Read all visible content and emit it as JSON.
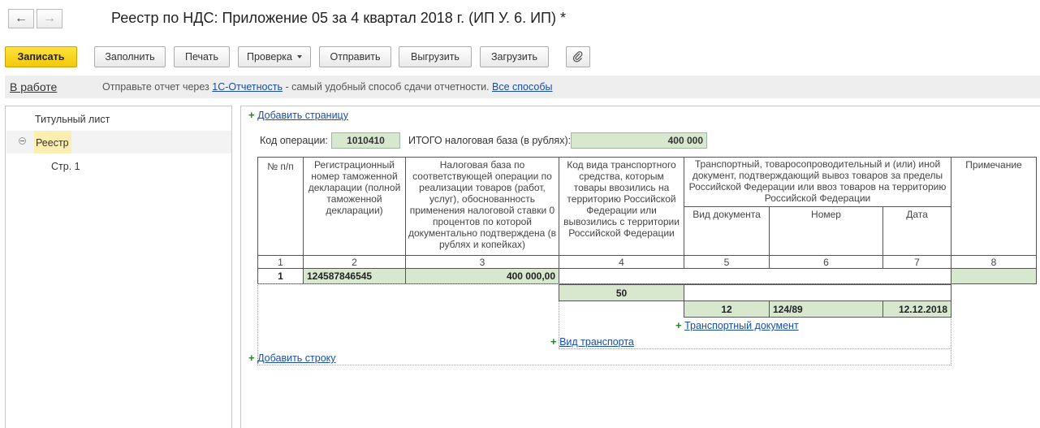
{
  "window": {
    "title": "Реестр по НДС: Приложение 05 за 4 квартал 2018 г. (ИП У. 6. ИП) *",
    "back_icon": "←",
    "forward_icon": "→"
  },
  "toolbar": {
    "save_label": "Записать",
    "fill_label": "Заполнить",
    "print_label": "Печать",
    "check_label": "Проверка",
    "send_label": "Отправить",
    "export_label": "Выгрузить",
    "import_label": "Загрузить"
  },
  "infobar": {
    "status": "В работе",
    "message_prefix": "Отправьте отчет через",
    "link_service": "1С-Отчетность",
    "message_suffix": "- самый удобный способ сдачи отчетности.",
    "link_all": "Все способы"
  },
  "tree": {
    "items": [
      "Титульный лист",
      "Реестр",
      "Стр. 1"
    ]
  },
  "form": {
    "add_page": "Добавить страницу",
    "op_code_label": "Код операции:",
    "op_code_value": "1010410",
    "total_label": "ИТОГО налоговая база (в рублях):",
    "total_value": "400 000",
    "add_row": "Добавить строку",
    "add_transport_doc": "Транспортный документ",
    "add_transport_type": "Вид транспорта"
  },
  "table": {
    "headers": {
      "c1": "№ п/п",
      "c2": "Регистрационный номер таможенной декларации (полной таможенной декларации)",
      "c3": "Налоговая база по соответствующей операции по реализации товаров (работ, услуг), обоснованность применения налоговой ставки 0 процентов по которой документально подтверждена (в рублях и копейках)",
      "c4": "Код вида транспортного средства, которым товары ввозились на территорию Российской Федерации или вывозились с территории Российской Федерации",
      "c5group": "Транспортный, товаросопроводительный и (или) иной документ, подтверждающий вывоз товаров за пределы Российской Федерации или ввоз товаров на территорию Российской Федерации",
      "c5": "Вид документа",
      "c6": "Номер",
      "c7": "Дата",
      "c8": "Примечание"
    },
    "numbers": [
      "1",
      "2",
      "3",
      "4",
      "5",
      "6",
      "7",
      "8"
    ],
    "row": {
      "num": "1",
      "declaration": "124587846545",
      "base": "400 000,00",
      "transport_code": "50",
      "doc_type": "12",
      "doc_number": "124/89",
      "doc_date": "12.12.2018"
    }
  },
  "colors": {
    "primary_button": "#f2c80a",
    "field_green": "#d7e8cf",
    "link": "#1a4da5",
    "add_plus": "#1f8a1f"
  }
}
